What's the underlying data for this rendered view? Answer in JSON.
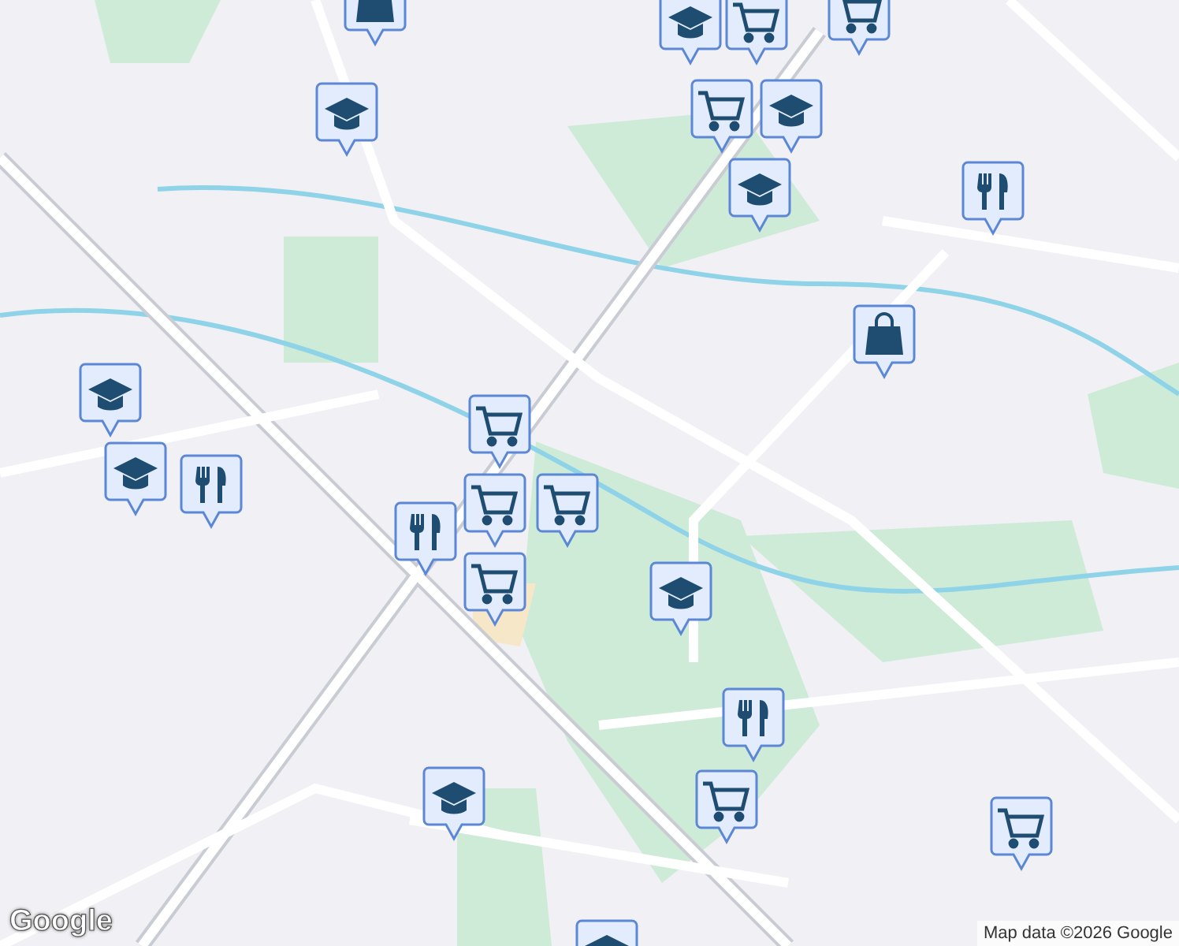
{
  "map": {
    "pins": [
      {
        "kind": "bag"
      },
      {
        "kind": "school"
      },
      {
        "kind": "cart"
      },
      {
        "kind": "cart"
      },
      {
        "kind": "school"
      },
      {
        "kind": "cart"
      },
      {
        "kind": "school"
      },
      {
        "kind": "school"
      },
      {
        "kind": "restaurant"
      },
      {
        "kind": "bag"
      },
      {
        "kind": "school"
      },
      {
        "kind": "school"
      },
      {
        "kind": "restaurant"
      },
      {
        "kind": "cart"
      },
      {
        "kind": "cart"
      },
      {
        "kind": "cart"
      },
      {
        "kind": "restaurant"
      },
      {
        "kind": "cart"
      },
      {
        "kind": "school"
      },
      {
        "kind": "restaurant"
      },
      {
        "kind": "cart"
      },
      {
        "kind": "cart"
      },
      {
        "kind": "school"
      },
      {
        "kind": "school"
      }
    ],
    "logo": "Google",
    "attribution": "Map data ©2026 Google"
  }
}
